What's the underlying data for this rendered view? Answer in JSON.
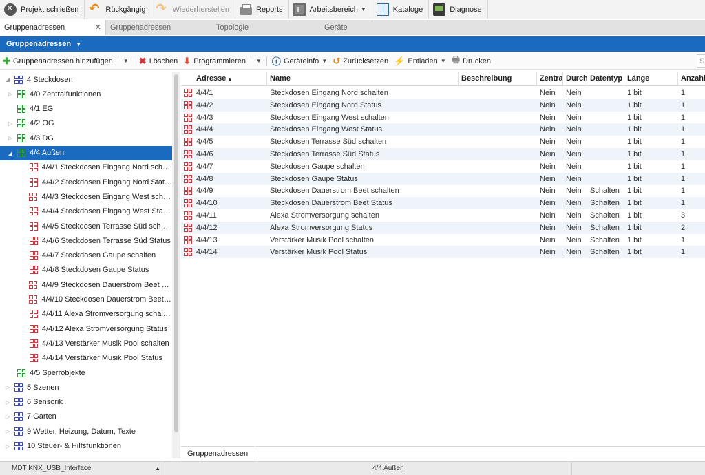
{
  "toolbar": {
    "buttons": [
      {
        "label": "Projekt schließen",
        "icon": "close-project-icon"
      },
      {
        "label": "Rückgängig",
        "icon": "undo-icon"
      },
      {
        "label": "Wiederherstellen",
        "icon": "redo-icon"
      },
      {
        "label": "Reports",
        "icon": "printer-icon"
      },
      {
        "label": "Arbeitsbereich",
        "icon": "workspace-icon"
      },
      {
        "label": "Kataloge",
        "icon": "catalog-icon"
      },
      {
        "label": "Diagnose",
        "icon": "diagnostics-icon"
      }
    ]
  },
  "tabs": [
    "Gruppenadressen",
    "Gruppenadressen",
    "Topologie",
    "Geräte"
  ],
  "panel": {
    "title": "Gruppenadressen"
  },
  "actions": {
    "add": "Gruppenadressen hinzufügen",
    "delete": "Löschen",
    "program": "Programmieren",
    "deviceinfo": "Geräteinfo",
    "reset": "Zurücksetzen",
    "unload": "Entladen",
    "print": "Drucken",
    "search_placeholder": "Suchen"
  },
  "tree": [
    {
      "label": "4 Steckdosen",
      "level": 0,
      "toggle": "◢",
      "icon": "blue"
    },
    {
      "label": "4/0 Zentralfunktionen",
      "level": 1,
      "toggle": "▷",
      "icon": "green"
    },
    {
      "label": "4/1 EG",
      "level": 1,
      "toggle": "",
      "icon": "green"
    },
    {
      "label": "4/2 OG",
      "level": 1,
      "toggle": "▷",
      "icon": "green"
    },
    {
      "label": "4/3 DG",
      "level": 1,
      "toggle": "▷",
      "icon": "green"
    },
    {
      "label": "4/4 Außen",
      "level": 1,
      "toggle": "◢",
      "icon": "green",
      "selected": true
    },
    {
      "label": "4/4/1 Steckdosen Eingang Nord schalten",
      "level": 2,
      "toggle": "",
      "icon": "red"
    },
    {
      "label": "4/4/2 Steckdosen Eingang Nord Status",
      "level": 2,
      "toggle": "",
      "icon": "red"
    },
    {
      "label": "4/4/3 Steckdosen Eingang West schalten",
      "level": 2,
      "toggle": "",
      "icon": "red"
    },
    {
      "label": "4/4/4 Steckdosen Eingang West Status",
      "level": 2,
      "toggle": "",
      "icon": "red"
    },
    {
      "label": "4/4/5 Steckdosen Terrasse Süd schalten",
      "level": 2,
      "toggle": "",
      "icon": "red"
    },
    {
      "label": "4/4/6 Steckdosen Terrasse Süd Status",
      "level": 2,
      "toggle": "",
      "icon": "red"
    },
    {
      "label": "4/4/7 Steckdosen Gaupe schalten",
      "level": 2,
      "toggle": "",
      "icon": "red"
    },
    {
      "label": "4/4/8 Steckdosen Gaupe Status",
      "level": 2,
      "toggle": "",
      "icon": "red"
    },
    {
      "label": "4/4/9 Steckdosen Dauerstrom Beet sch...",
      "level": 2,
      "toggle": "",
      "icon": "red"
    },
    {
      "label": "4/4/10 Steckdosen Dauerstrom Beet St...",
      "level": 2,
      "toggle": "",
      "icon": "red"
    },
    {
      "label": "4/4/11 Alexa Stromversorgung schalten",
      "level": 2,
      "toggle": "",
      "icon": "red"
    },
    {
      "label": "4/4/12 Alexa Stromversorgung Status",
      "level": 2,
      "toggle": "",
      "icon": "red"
    },
    {
      "label": "4/4/13 Verstärker Musik Pool schalten",
      "level": 2,
      "toggle": "",
      "icon": "red"
    },
    {
      "label": "4/4/14 Verstärker Musik Pool Status",
      "level": 2,
      "toggle": "",
      "icon": "red"
    },
    {
      "label": "4/5 Sperrobjekte",
      "level": 1,
      "toggle": "",
      "icon": "green"
    },
    {
      "label": "5 Szenen",
      "level": 0,
      "toggle": "▷",
      "icon": "blue"
    },
    {
      "label": "6 Sensorik",
      "level": 0,
      "toggle": "▷",
      "icon": "blue"
    },
    {
      "label": "7 Garten",
      "level": 0,
      "toggle": "▷",
      "icon": "blue"
    },
    {
      "label": "9 Wetter, Heizung, Datum, Texte",
      "level": 0,
      "toggle": "▷",
      "icon": "blue"
    },
    {
      "label": "10 Steuer- & Hilfsfunktionen",
      "level": 0,
      "toggle": "▷",
      "icon": "blue"
    }
  ],
  "grid": {
    "columns": [
      "Adresse",
      "Name",
      "Beschreibung",
      "Zentral",
      "Durch",
      "Datentyp",
      "Länge",
      "Anzahl"
    ],
    "rows": [
      [
        "4/4/1",
        "Steckdosen Eingang Nord schalten",
        "",
        "Nein",
        "Nein",
        "",
        "1 bit",
        "1"
      ],
      [
        "4/4/2",
        "Steckdosen Eingang Nord Status",
        "",
        "Nein",
        "Nein",
        "",
        "1 bit",
        "1"
      ],
      [
        "4/4/3",
        "Steckdosen Eingang West schalten",
        "",
        "Nein",
        "Nein",
        "",
        "1 bit",
        "1"
      ],
      [
        "4/4/4",
        "Steckdosen Eingang West Status",
        "",
        "Nein",
        "Nein",
        "",
        "1 bit",
        "1"
      ],
      [
        "4/4/5",
        "Steckdosen Terrasse Süd schalten",
        "",
        "Nein",
        "Nein",
        "",
        "1 bit",
        "1"
      ],
      [
        "4/4/6",
        "Steckdosen Terrasse Süd Status",
        "",
        "Nein",
        "Nein",
        "",
        "1 bit",
        "1"
      ],
      [
        "4/4/7",
        "Steckdosen Gaupe schalten",
        "",
        "Nein",
        "Nein",
        "",
        "1 bit",
        "1"
      ],
      [
        "4/4/8",
        "Steckdosen Gaupe Status",
        "",
        "Nein",
        "Nein",
        "",
        "1 bit",
        "1"
      ],
      [
        "4/4/9",
        "Steckdosen Dauerstrom Beet schalten",
        "",
        "Nein",
        "Nein",
        "Schalten",
        "1 bit",
        "1"
      ],
      [
        "4/4/10",
        "Steckdosen Dauerstrom Beet Status",
        "",
        "Nein",
        "Nein",
        "Schalten",
        "1 bit",
        "1"
      ],
      [
        "4/4/11",
        "Alexa Stromversorgung schalten",
        "",
        "Nein",
        "Nein",
        "Schalten",
        "1 bit",
        "3"
      ],
      [
        "4/4/12",
        "Alexa Stromversorgung Status",
        "",
        "Nein",
        "Nein",
        "Schalten",
        "1 bit",
        "2"
      ],
      [
        "4/4/13",
        "Verstärker Musik Pool schalten",
        "",
        "Nein",
        "Nein",
        "Schalten",
        "1 bit",
        "1"
      ],
      [
        "4/4/14",
        "Verstärker Musik Pool Status",
        "",
        "Nein",
        "Nein",
        "Schalten",
        "1 bit",
        "1"
      ]
    ]
  },
  "bottom_tab": "Gruppenadressen",
  "status": {
    "interface": "MDT KNX_USB_Interface",
    "selection": "4/4 Außen"
  },
  "colors": {
    "accent": "#1a6bbf",
    "row_alt": "#eef4fa",
    "group_main": "#3c48c8",
    "group_middle": "#2e9a3c",
    "group_address": "#d9343a"
  }
}
